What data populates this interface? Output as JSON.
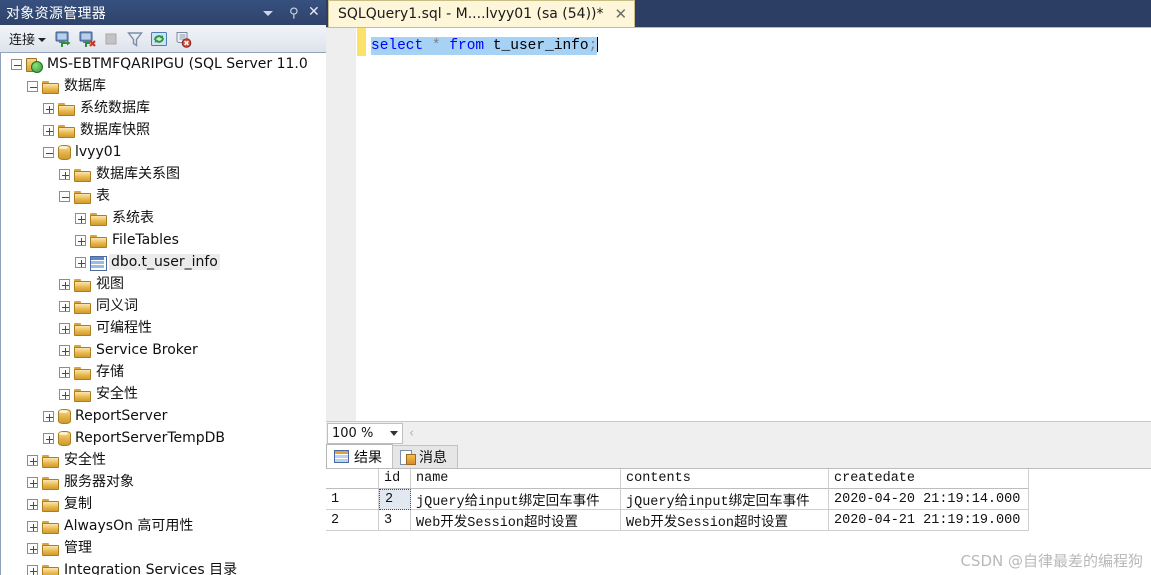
{
  "object_explorer": {
    "title": "对象资源管理器",
    "titlebar_buttons": [
      {
        "name": "dropdown",
        "icon": "chevron-down-icon"
      },
      {
        "name": "pin",
        "icon": "pin-icon",
        "glyph": "⚲"
      },
      {
        "name": "close",
        "icon": "close-icon",
        "glyph": "✕"
      }
    ],
    "toolbar": {
      "connect_label": "连接",
      "buttons": [
        {
          "name": "connect",
          "icon": "connect-icon"
        },
        {
          "name": "disconnect",
          "icon": "disconnect-icon"
        },
        {
          "name": "stop",
          "icon": "stop-icon",
          "disabled": true
        },
        {
          "name": "filter",
          "icon": "filter-icon"
        },
        {
          "name": "refresh",
          "icon": "refresh-icon"
        },
        {
          "name": "stop-script",
          "icon": "script-stop-icon"
        }
      ]
    },
    "tree": [
      {
        "label": "MS-EBTMFQARIPGU (SQL Server 11.0",
        "depth": 0,
        "state": "expanded",
        "icon": "server-icon"
      },
      {
        "label": "数据库",
        "depth": 1,
        "state": "expanded",
        "icon": "folder-icon"
      },
      {
        "label": "系统数据库",
        "depth": 2,
        "state": "collapsed",
        "icon": "folder-icon"
      },
      {
        "label": "数据库快照",
        "depth": 2,
        "state": "collapsed",
        "icon": "folder-icon"
      },
      {
        "label": "lvyy01",
        "depth": 2,
        "state": "expanded",
        "icon": "database-icon"
      },
      {
        "label": "数据库关系图",
        "depth": 3,
        "state": "collapsed",
        "icon": "folder-icon"
      },
      {
        "label": "表",
        "depth": 3,
        "state": "expanded",
        "icon": "folder-icon"
      },
      {
        "label": "系统表",
        "depth": 4,
        "state": "collapsed",
        "icon": "folder-icon"
      },
      {
        "label": "FileTables",
        "depth": 4,
        "state": "collapsed",
        "icon": "folder-icon"
      },
      {
        "label": "dbo.t_user_info",
        "depth": 4,
        "state": "collapsed",
        "icon": "table-icon",
        "selected": true
      },
      {
        "label": "视图",
        "depth": 3,
        "state": "collapsed",
        "icon": "folder-icon"
      },
      {
        "label": "同义词",
        "depth": 3,
        "state": "collapsed",
        "icon": "folder-icon"
      },
      {
        "label": "可编程性",
        "depth": 3,
        "state": "collapsed",
        "icon": "folder-icon"
      },
      {
        "label": "Service Broker",
        "depth": 3,
        "state": "collapsed",
        "icon": "folder-icon"
      },
      {
        "label": "存储",
        "depth": 3,
        "state": "collapsed",
        "icon": "folder-icon"
      },
      {
        "label": "安全性",
        "depth": 3,
        "state": "collapsed",
        "icon": "folder-icon"
      },
      {
        "label": "ReportServer",
        "depth": 2,
        "state": "collapsed",
        "icon": "database-icon"
      },
      {
        "label": "ReportServerTempDB",
        "depth": 2,
        "state": "collapsed",
        "icon": "database-icon"
      },
      {
        "label": "安全性",
        "depth": 1,
        "state": "collapsed",
        "icon": "folder-icon"
      },
      {
        "label": "服务器对象",
        "depth": 1,
        "state": "collapsed",
        "icon": "folder-icon"
      },
      {
        "label": "复制",
        "depth": 1,
        "state": "collapsed",
        "icon": "folder-icon"
      },
      {
        "label": "AlwaysOn 高可用性",
        "depth": 1,
        "state": "collapsed",
        "icon": "folder-icon"
      },
      {
        "label": "管理",
        "depth": 1,
        "state": "collapsed",
        "icon": "folder-icon"
      },
      {
        "label": "Integration Services 目录",
        "depth": 1,
        "state": "collapsed",
        "icon": "folder-icon"
      }
    ]
  },
  "editor": {
    "tab_title": "SQLQuery1.sql - M....lvyy01 (sa (54))*",
    "close_glyph": "✕",
    "code": {
      "keyword1": "select",
      "star": "*",
      "keyword2": "from",
      "identifier": "t_user_info",
      "terminator": ";",
      "full_text": "select * from t_user_info;",
      "selected": true
    }
  },
  "zoombar": {
    "zoom_value": "100 %",
    "splitter_glyph": "‹"
  },
  "results": {
    "tabs": [
      {
        "label": "结果",
        "icon": "grid-icon",
        "active": true
      },
      {
        "label": "消息",
        "icon": "message-icon",
        "active": false
      }
    ],
    "columns": [
      "",
      "id",
      "name",
      "contents",
      "createdate"
    ],
    "rows": [
      {
        "num": "1",
        "id": "2",
        "name": "jQuery给input绑定回车事件",
        "contents": "jQuery给input绑定回车事件",
        "createdate": "2020-04-20 21:19:14.000",
        "focused_cell": "id"
      },
      {
        "num": "2",
        "id": "3",
        "name": "Web开发Session超时设置",
        "contents": "Web开发Session超时设置",
        "createdate": "2020-04-21 21:19:19.000"
      }
    ]
  },
  "watermark": "CSDN @自律最差的编程狗"
}
